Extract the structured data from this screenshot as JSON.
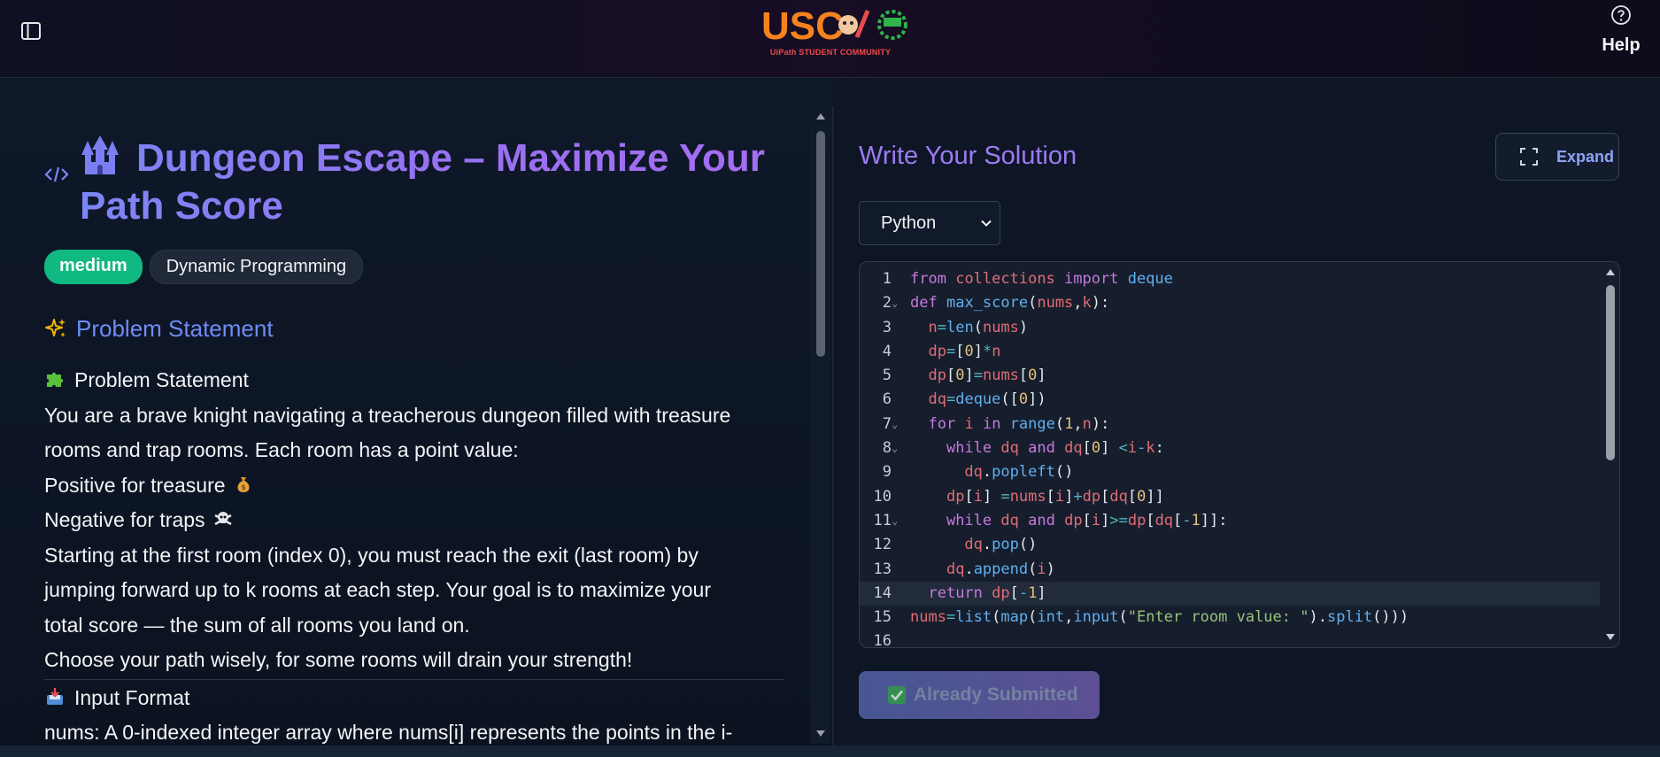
{
  "header": {
    "logo_text": "USC",
    "logo_subtitle": "UiPath STUDENT COMMUNITY",
    "help_label": "Help",
    "icons": [
      "sidebar-toggle-icon",
      "help-circle-icon"
    ]
  },
  "problem": {
    "title": "Dungeon Escape – Maximize Your Path Score",
    "title_icon": "castle-icon",
    "tags": {
      "difficulty": "medium",
      "topic": "Dynamic Programming"
    },
    "section_heading": "Problem Statement",
    "statement_heading": "Problem Statement",
    "lines": {
      "l1": "You are a brave knight navigating a treacherous dungeon filled with treasure",
      "l2": "rooms and trap rooms. Each room has a point value:",
      "l3": "Positive for treasure",
      "l4": "Negative for traps",
      "l5": "Starting at the first room (index 0), you must reach the exit (last room) by",
      "l6": "jumping forward up to k rooms at each step. Your goal is to maximize your",
      "l7": "total score — the sum of all rooms you land on.",
      "l8": "Choose your path wisely, for some rooms will drain your strength!"
    },
    "input_heading": "Input Format",
    "input_line": "nums: A 0-indexed integer array where nums[i] represents the points in the i-"
  },
  "editor_panel": {
    "title": "Write Your Solution",
    "expand_label": "Expand",
    "language": "Python",
    "submit_label": "Already Submitted",
    "line_numbers": [
      "1",
      "2",
      "3",
      "4",
      "5",
      "6",
      "7",
      "8",
      "9",
      "10",
      "11",
      "12",
      "13",
      "14",
      "15",
      "16"
    ],
    "code": [
      "from collections import deque",
      "def max_score(nums,k):",
      "  n=len(nums)",
      "  dp=[0]*n",
      "  dp[0]=nums[0]",
      "  dq=deque([0])",
      "  for i in range(1,n):",
      "    while dq and dq[0] <i-k:",
      "      dq.popleft()",
      "    dp[i] =nums[i]+dp[dq[0]]",
      "    while dq and dp[i]>=dp[dq[-1]]:",
      "      dq.pop()",
      "    dq.append(i)",
      "  return dp[-1]",
      "nums=list(map(int,input(\"Enter room value: \").split()))",
      ""
    ]
  },
  "colors": {
    "accent_purple": "#9b7bf2",
    "accent_blue": "#6e8cf6",
    "tag_green": "#10b981",
    "background": "#0f1623"
  }
}
